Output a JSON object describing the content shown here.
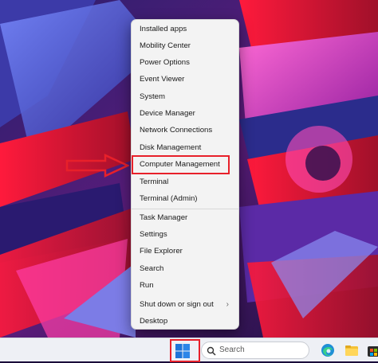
{
  "menu": {
    "items": [
      {
        "label": "Installed apps"
      },
      {
        "label": "Mobility Center"
      },
      {
        "label": "Power Options"
      },
      {
        "label": "Event Viewer"
      },
      {
        "label": "System"
      },
      {
        "label": "Device Manager"
      },
      {
        "label": "Network Connections"
      },
      {
        "label": "Disk Management"
      },
      {
        "label": "Computer Management"
      },
      {
        "label": "Terminal"
      },
      {
        "label": "Terminal (Admin)"
      },
      {
        "label": "Task Manager"
      },
      {
        "label": "Settings"
      },
      {
        "label": "File Explorer"
      },
      {
        "label": "Search"
      },
      {
        "label": "Run"
      },
      {
        "label": "Shut down or sign out"
      },
      {
        "label": "Desktop"
      }
    ],
    "highlighted_item": "Computer Management",
    "submenu_indicator": "›"
  },
  "taskbar": {
    "search_placeholder": "Search",
    "icons": [
      "windows-start-icon",
      "search-icon",
      "edge-browser-icon",
      "file-explorer-icon",
      "store-icon"
    ]
  },
  "colors": {
    "annotation_red": "#e8202a",
    "menu_background": "#f3f3f3",
    "taskbar_background": "#eef0f5"
  }
}
